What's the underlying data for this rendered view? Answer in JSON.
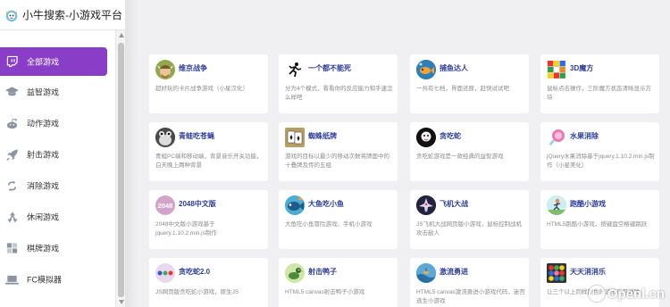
{
  "site": {
    "title": "小牛搜索-小游戏平台",
    "logo_icon": "bull-mascot-logo"
  },
  "sidebar": {
    "items": [
      {
        "label": "全部游戏",
        "icon": "twitch-icon",
        "active": true
      },
      {
        "label": "益智游戏",
        "icon": "graduation-cap-icon"
      },
      {
        "label": "动作游戏",
        "icon": "reddit-alien-icon"
      },
      {
        "label": "射击游戏",
        "icon": "rocket-icon"
      },
      {
        "label": "消除游戏",
        "icon": "refresh-icon"
      },
      {
        "label": "休闲游戏",
        "icon": "recycle-icon"
      },
      {
        "label": "棋牌游戏",
        "icon": "grid-icon"
      },
      {
        "label": "FC模拟器",
        "icon": "laptop-icon"
      }
    ]
  },
  "games": [
    {
      "title": "维京战争",
      "desc": "超好玩的卡片战争游戏（小星汉化）",
      "icon": "viking-icon",
      "color": "#8fa94a"
    },
    {
      "title": "一个都不能死",
      "desc": "分为4个模式，看看你的反应能力和手速怎么样吧",
      "icon": "running-man-icon",
      "color": "#ffffff"
    },
    {
      "title": "捕鱼达人",
      "desc": "一共有七档，界面还原，赶快试试吧",
      "icon": "fish-icon",
      "color": "#3a8fc4"
    },
    {
      "title": "3D魔方",
      "desc": "鼠标点击操作，三阶魔方状态清晰显示方块",
      "icon": "rubiks-cube-icon",
      "color": "#d8d8d8"
    },
    {
      "title": "青蛙吃苍蝇",
      "desc": "青蛙PC端和移动端，背景音乐开关功能，白天晚上两种背景",
      "icon": "frog-icon",
      "color": "#555555"
    },
    {
      "title": "蜘蛛纸牌",
      "desc": "游戏的目标以最少的移动次数将牌面中的十叠牌及传的五组",
      "icon": "playing-cards-icon",
      "color": "#c9b27a"
    },
    {
      "title": "贪吃蛇",
      "desc": "贪吃蛇游戏是一款经典的益智游戏",
      "icon": "snake-icon",
      "color": "#222222"
    },
    {
      "title": "水果消除",
      "desc": "jQuery水果消除基于jquery.1.10.2.min.js制作（小星美化）",
      "icon": "candy-icon",
      "color": "#e97ab3"
    },
    {
      "title": "2048中文版",
      "desc": "2048中文版小游戏基于jquery.1.10.2.min.js制作",
      "icon": "2048-icon",
      "color": "#d4a3c9",
      "icon_text": "2048"
    },
    {
      "title": "大鱼吃小鱼",
      "desc": "大鱼吃小鱼冒险游戏、手机小游戏",
      "icon": "big-fish-icon",
      "color": "#5bb8d9"
    },
    {
      "title": "飞机大战",
      "desc": "JS飞机大战网页版小游戏，鼠标控制战机攻击敌人",
      "icon": "plane-icon",
      "color": "#2a2a4a"
    },
    {
      "title": "跑酷小游戏",
      "desc": "HTML5跑酷小游戏，按键盘空格键跳跃",
      "icon": "parkour-icon",
      "color": "#a6dbe6"
    },
    {
      "title": "贪吃蛇2.0",
      "desc": "JS网页版贪吃蛇小游戏，原生JS",
      "icon": "snake-dots-icon",
      "color": "#e8d6ee"
    },
    {
      "title": "射击鸭子",
      "desc": "HTML5 canvas射击鸭子小游戏",
      "icon": "duck-icon",
      "color": "#b7d48a"
    },
    {
      "title": "激流勇进",
      "desc": "HTML5 canvas激流勇进小游戏代码，迷宫逃生小游戏",
      "icon": "rapids-icon",
      "color": "#3f8fbf"
    },
    {
      "title": "天天消消乐",
      "desc": "让三个以上同样颜色的消消乐可消除",
      "icon": "match-three-icon",
      "color": "#3a3a3a"
    }
  ],
  "watermark": {
    "text": "Openl.cn",
    "icon": "watermark-logo"
  }
}
